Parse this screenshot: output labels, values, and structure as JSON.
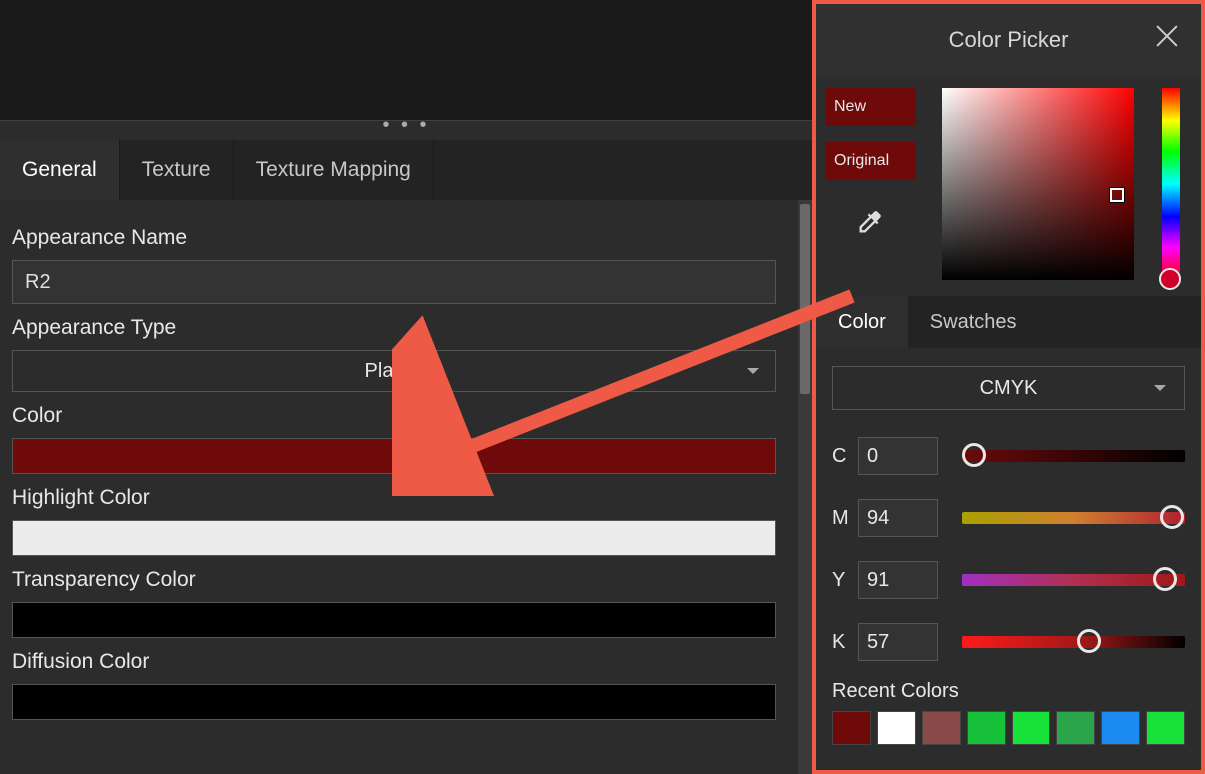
{
  "tabs": [
    "General",
    "Texture",
    "Texture Mapping"
  ],
  "activeTab": 0,
  "fields": {
    "appearanceName": {
      "label": "Appearance Name",
      "value": "R2"
    },
    "appearanceType": {
      "label": "Appearance Type",
      "value": "Plastic"
    },
    "color": {
      "label": "Color",
      "swatch": "#6e0a0a"
    },
    "highlightColor": {
      "label": "Highlight Color",
      "swatch": "#ececec"
    },
    "transparencyColor": {
      "label": "Transparency Color",
      "swatch": "#000000"
    },
    "diffusionColor": {
      "label": "Diffusion Color",
      "swatch": "#000000"
    }
  },
  "colorPicker": {
    "title": "Color Picker",
    "newLabel": "New",
    "originalLabel": "Original",
    "newColor": "#6e0a0a",
    "originalColor": "#6e0a0a",
    "subtabs": [
      "Color",
      "Swatches"
    ],
    "activeSubtab": 0,
    "model": "CMYK",
    "channels": {
      "C": 0,
      "M": 94,
      "Y": 91,
      "K": 57
    },
    "recentLabel": "Recent Colors",
    "recentColors": [
      "#6e0a0a",
      "#ffffff",
      "#8a4a4a",
      "#17c23a",
      "#17e23a",
      "#2aa54a",
      "#1a8af0",
      "#17e23a"
    ]
  }
}
